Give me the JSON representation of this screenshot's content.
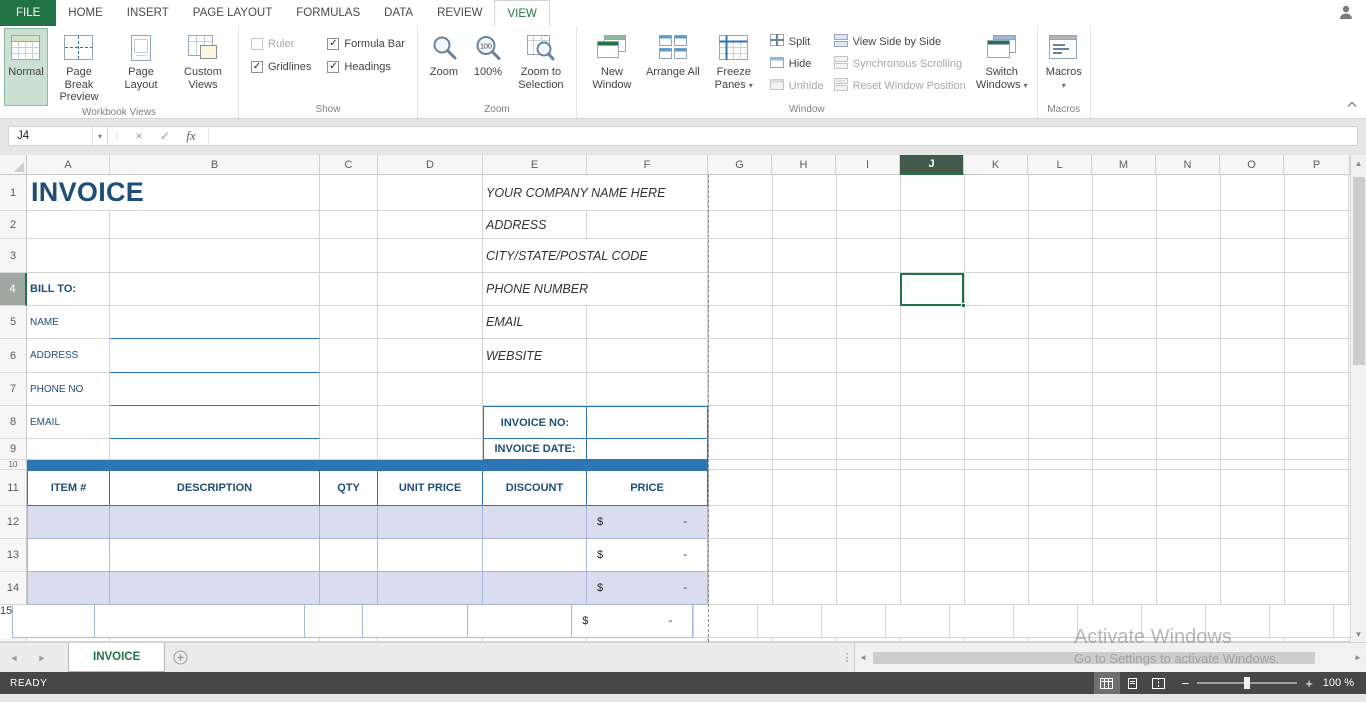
{
  "ribbon": {
    "file": "FILE",
    "tabs": [
      "HOME",
      "INSERT",
      "PAGE LAYOUT",
      "FORMULAS",
      "DATA",
      "REVIEW",
      "VIEW"
    ],
    "workbook_views": {
      "group_label": "Workbook Views",
      "normal": "Normal",
      "page_break_preview": "Page Break Preview",
      "page_layout": "Page Layout",
      "custom_views": "Custom Views"
    },
    "show": {
      "group_label": "Show",
      "ruler": "Ruler",
      "formula_bar": "Formula Bar",
      "gridlines": "Gridlines",
      "headings": "Headings"
    },
    "zoom": {
      "group_label": "Zoom",
      "zoom": "Zoom",
      "zoom_100": "100%",
      "zoom_to_selection": "Zoom to Selection"
    },
    "window_group": {
      "group_label": "Window",
      "new_window": "New Window",
      "arrange_all": "Arrange All",
      "freeze_panes": "Freeze Panes",
      "split": "Split",
      "hide": "Hide",
      "unhide": "Unhide",
      "view_side_by_side": "View Side by Side",
      "synchronous_scrolling": "Synchronous Scrolling",
      "reset_window_position": "Reset Window Position",
      "switch_windows": "Switch Windows"
    },
    "macros": {
      "group_label": "Macros",
      "button": "Macros"
    }
  },
  "formula_bar": {
    "name_box": "J4",
    "fx_label": "fx",
    "formula_value": ""
  },
  "grid": {
    "columns": [
      "A",
      "B",
      "C",
      "D",
      "E",
      "F",
      "G",
      "H",
      "I",
      "J",
      "K",
      "L",
      "M",
      "N",
      "O",
      "P"
    ],
    "rows": [
      "1",
      "2",
      "3",
      "4",
      "5",
      "6",
      "7",
      "8",
      "9",
      "10",
      "11",
      "12",
      "13",
      "14",
      "15"
    ],
    "active_cell": "J4"
  },
  "invoice": {
    "title": "INVOICE",
    "company": {
      "name": "YOUR COMPANY NAME HERE",
      "address": "ADDRESS",
      "city": "CITY/STATE/POSTAL CODE",
      "phone": "PHONE NUMBER",
      "email": "EMAIL",
      "website": "WEBSITE"
    },
    "bill_to": "BILL TO:",
    "labels": {
      "name": "NAME",
      "address": "ADDRESS",
      "phone": "PHONE NO",
      "email": "EMAIL"
    },
    "invoice_no_label": "INVOICE NO:",
    "invoice_date_label": "INVOICE DATE:",
    "table": {
      "headers": [
        "ITEM #",
        "DESCRIPTION",
        "QTY",
        "UNIT PRICE",
        "DISCOUNT",
        "PRICE"
      ],
      "currency": "$",
      "empty_amount": "-"
    }
  },
  "sheet_bar": {
    "tab": "INVOICE"
  },
  "status_bar": {
    "ready": "READY",
    "zoom_level": "100 %"
  },
  "watermark": {
    "line1": "Activate Windows",
    "line2": "Go to Settings to activate Windows."
  },
  "icons": {
    "caret_down": "▾",
    "arrow_up": "▲",
    "arrow_down": "▼",
    "arrow_left": "◄",
    "arrow_right": "►",
    "check": "✓",
    "cancel": "×",
    "dots_vertical": "⋮",
    "minus": "−",
    "plus": "+"
  },
  "colors": {
    "excel_green": "#217346",
    "invoice_navy": "#1f4e79",
    "band_blue": "#2e75b6",
    "row_shade": "#dadcf0"
  }
}
